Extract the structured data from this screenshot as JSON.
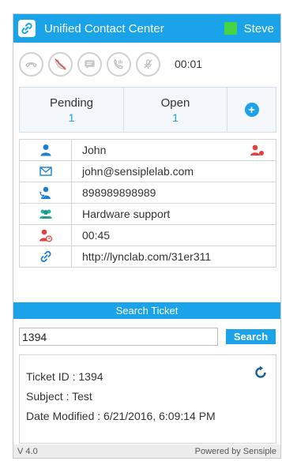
{
  "header": {
    "title": "Unified Contact Center",
    "user": "Steve",
    "status_color": "#44d544",
    "accent": "#1aa3e8"
  },
  "controls": {
    "buttons": [
      "hang-up-icon",
      "phone-muted-icon",
      "chat-icon",
      "voicemail-icon",
      "mic-off-icon"
    ],
    "timer": "00:01"
  },
  "queues": {
    "pending": {
      "label": "Pending",
      "count": "1"
    },
    "open": {
      "label": "Open",
      "count": "1"
    },
    "add": "plus-icon"
  },
  "contact": {
    "name": "John",
    "email": "john@sensiplelab.com",
    "phone": "898989898989",
    "department": "Hardware support",
    "duration": "00:45",
    "link": "http://lynclab.com/31er311"
  },
  "search": {
    "header": "Search Ticket",
    "value": "1394",
    "button": "Search"
  },
  "ticket": {
    "id_line": "Ticket ID : 1394",
    "subject_line": "Subject : Test",
    "date_line": "Date Modified : 6/21/2016, 6:09:14 PM"
  },
  "footer": {
    "version": "V 4.0",
    "powered": "Powered by Sensiple"
  }
}
